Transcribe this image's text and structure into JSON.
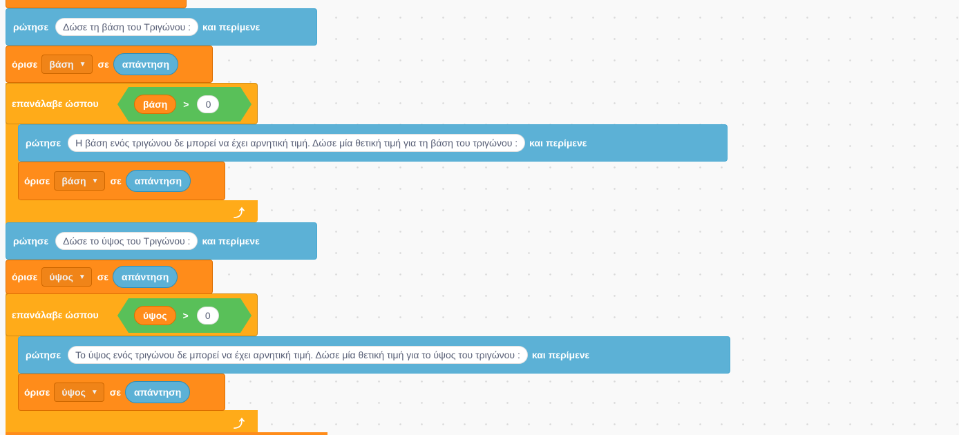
{
  "blocks": {
    "b1_keyword": "ρώτησε",
    "b1_prompt": "Δώσε τη βάση του Τριγώνου :",
    "b1_wait": "και περίμενε",
    "b2_keyword": "όρισε",
    "b2_var": "βάση",
    "b2_to": "σε",
    "b2_value": "απάντηση",
    "b3_keyword": "επανάλαβε ώσπου",
    "b3_var": "βάση",
    "b3_op": ">",
    "b3_num": "0",
    "b4_keyword": "ρώτησε",
    "b4_prompt": "Η βάση ενός τριγώνου δε μπορεί να έχει αρνητική τιμή. Δώσε μία θετική τιμή για τη βάση του τριγώνου :",
    "b4_wait": "και περίμενε",
    "b5_keyword": "όρισε",
    "b5_var": "βάση",
    "b5_to": "σε",
    "b5_value": "απάντηση",
    "b6_keyword": "ρώτησε",
    "b6_prompt": "Δώσε το ύψος του Τριγώνου :",
    "b6_wait": "και περίμενε",
    "b7_keyword": "όρισε",
    "b7_var": "ύψος",
    "b7_to": "σε",
    "b7_value": "απάντηση",
    "b8_keyword": "επανάλαβε ώσπου",
    "b8_var": "ύψος",
    "b8_op": ">",
    "b8_num": "0",
    "b9_keyword": "ρώτησε",
    "b9_prompt": "Το ύψος ενός τριγώνου δε μπορεί να έχει αρνητική τιμή. Δώσε μία θετική τιμή για το ύψος του τριγώνου :",
    "b9_wait": "και περίμενε",
    "b10_keyword": "όρισε",
    "b10_var": "ύψος",
    "b10_to": "σε",
    "b10_value": "απάντηση"
  },
  "icons": {
    "dropdown": "caret-down-icon",
    "loop_arrow": "loop-arrow-icon"
  },
  "colors": {
    "sensing": "#5cb1d6",
    "variables": "#ff8c1a",
    "control": "#ffab19",
    "operators": "#59c059",
    "workspace": "#f9f9f9"
  }
}
